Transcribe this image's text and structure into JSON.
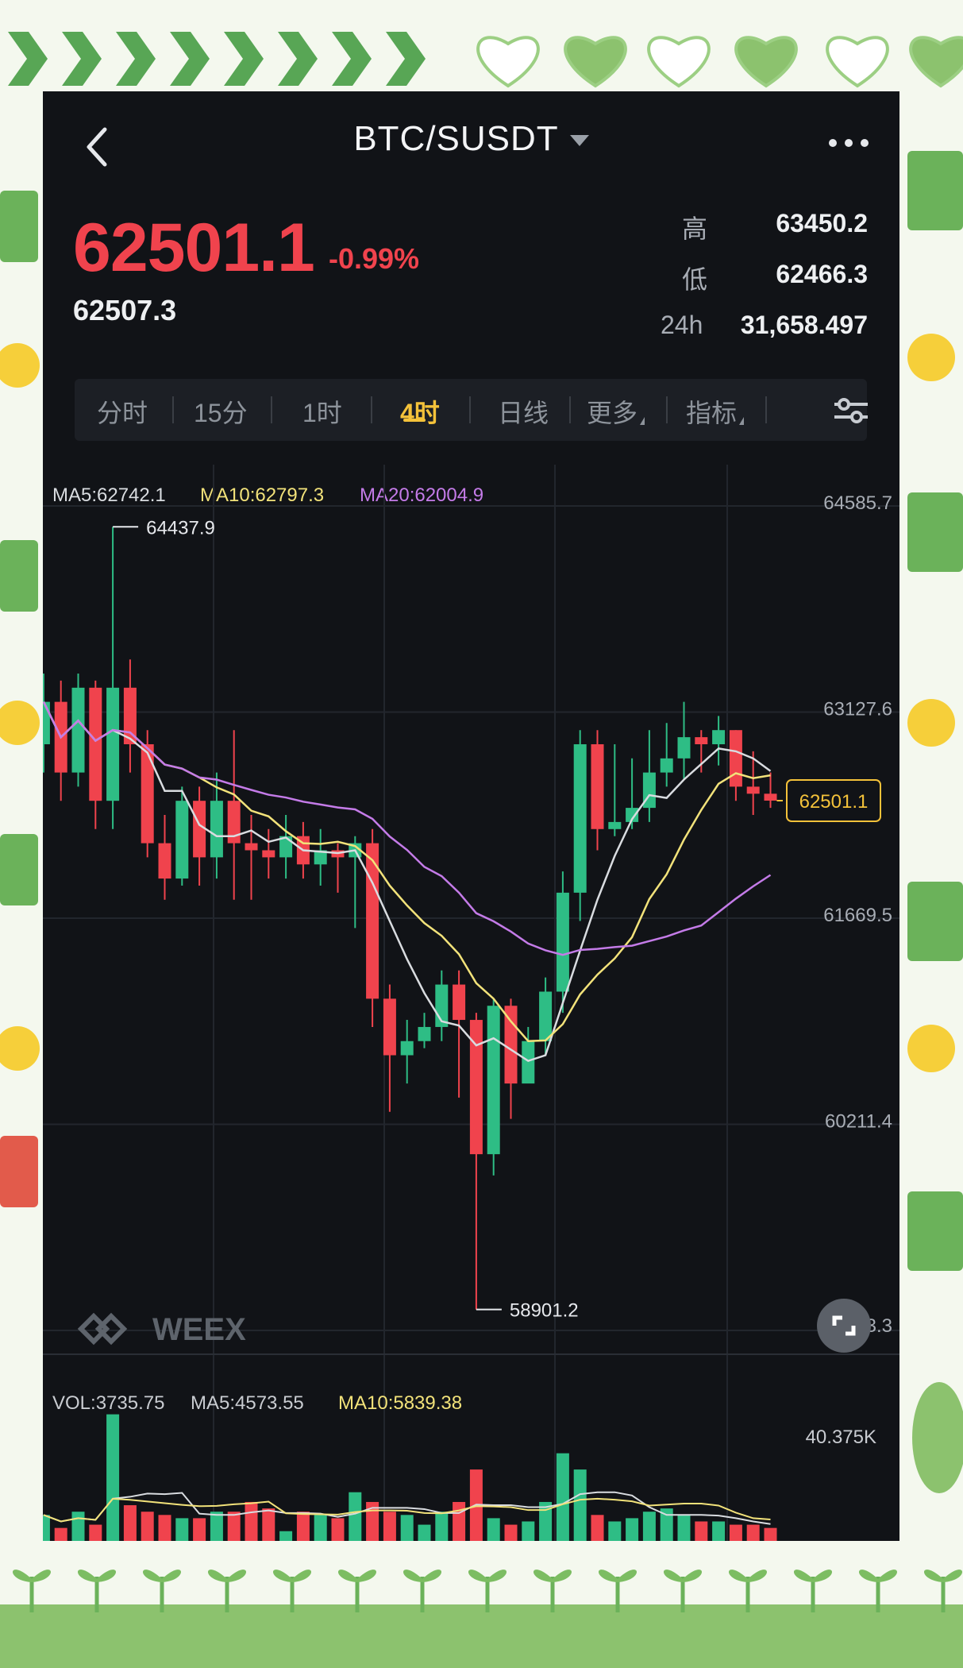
{
  "header": {
    "pair": "BTC/SUSDT"
  },
  "ticker": {
    "last_price": "62501.1",
    "change_pct": "-0.99%",
    "index_price": "62507.3",
    "high_label": "高",
    "high": "63450.2",
    "low_label": "低",
    "low": "62466.3",
    "vol_label": "24h",
    "vol_24h": "31,658.497"
  },
  "tabs": [
    {
      "label": "分时"
    },
    {
      "label": "15分"
    },
    {
      "label": "1时"
    },
    {
      "label": "4时"
    },
    {
      "label": "日线"
    },
    {
      "label": "更多"
    },
    {
      "label": "指标"
    }
  ],
  "active_tab": "4时",
  "ma": {
    "ma5": "MA5:62742.1",
    "ma10": "MA10:62797.3",
    "ma20": "MA20:62004.9"
  },
  "price_axis": [
    "64585.7",
    "63127.6",
    "61669.5",
    "60211.4",
    "58753.3"
  ],
  "annotations": {
    "high_mark": "64437.9",
    "low_mark": "58901.2",
    "current_tag": "62501.1"
  },
  "volume": {
    "vol": "VOL:3735.75",
    "ma5": "MA5:4573.55",
    "ma10": "MA10:5839.38",
    "axis_max": "40.375K"
  },
  "brand": {
    "logo_text": "WEEX"
  },
  "colors": {
    "up": "#2ebd85",
    "down": "#f0434d",
    "ma5": "#d9dce0",
    "ma10": "#f2e27a",
    "ma20": "#c47be8",
    "accent": "#f4c23a"
  },
  "chart_data": {
    "type": "candlestick",
    "ylim": [
      58753.3,
      64585.7
    ],
    "candles": [
      [
        62900,
        63200,
        63400,
        62700
      ],
      [
        63200,
        62700,
        63350,
        62500
      ],
      [
        62700,
        63300,
        63400,
        62600
      ],
      [
        63300,
        62500,
        63350,
        62300
      ],
      [
        62500,
        63300,
        64437.9,
        62300
      ],
      [
        63300,
        62900,
        63500,
        62700
      ],
      [
        62900,
        62200,
        63000,
        62100
      ],
      [
        62200,
        61950,
        62400,
        61800
      ],
      [
        61950,
        62500,
        62600,
        61900
      ],
      [
        62500,
        62100,
        62600,
        61900
      ],
      [
        62100,
        62500,
        62700,
        61950
      ],
      [
        62500,
        62200,
        63000,
        61800
      ],
      [
        62200,
        62150,
        62400,
        61800
      ],
      [
        62150,
        62100,
        62300,
        61950
      ],
      [
        62100,
        62250,
        62400,
        61950
      ],
      [
        62250,
        62050,
        62350,
        61950
      ],
      [
        62050,
        62150,
        62300,
        61900
      ],
      [
        62150,
        62100,
        62200,
        61850
      ],
      [
        62100,
        62200,
        62250,
        61600
      ],
      [
        62200,
        61100,
        62300,
        60900
      ],
      [
        61100,
        60700,
        61200,
        60300
      ],
      [
        60700,
        60800,
        60950,
        60500
      ],
      [
        60800,
        60900,
        61000,
        60750
      ],
      [
        60900,
        61200,
        61300,
        60800
      ],
      [
        61200,
        60950,
        61300,
        60400
      ],
      [
        60950,
        60000,
        61000,
        58901.2
      ],
      [
        60000,
        61050,
        61100,
        59850
      ],
      [
        61050,
        60500,
        61100,
        60250
      ],
      [
        60500,
        60800,
        60900,
        60600
      ],
      [
        60800,
        61150,
        61250,
        60700
      ],
      [
        61150,
        61850,
        62000,
        61000
      ],
      [
        61850,
        62900,
        63000,
        61650
      ],
      [
        62900,
        62300,
        63000,
        62150
      ],
      [
        62300,
        62350,
        62900,
        62250
      ],
      [
        62350,
        62450,
        62800,
        62300
      ],
      [
        62450,
        62700,
        63000,
        62350
      ],
      [
        62700,
        62800,
        63050,
        62600
      ],
      [
        62800,
        62950,
        63200,
        62650
      ],
      [
        62950,
        62900,
        63000,
        62700
      ],
      [
        62900,
        63000,
        63100,
        62750
      ],
      [
        63000,
        62600,
        63000,
        62500
      ],
      [
        62600,
        62550,
        62850,
        62400
      ],
      [
        62550,
        62501.1,
        62700,
        62450
      ]
    ],
    "volumes": [
      8,
      4,
      9,
      5,
      39,
      11,
      9,
      8,
      7,
      7,
      9,
      9,
      12,
      10,
      3,
      9,
      8,
      7,
      15,
      12,
      9,
      8,
      5,
      9,
      12,
      22,
      7,
      5,
      6,
      12,
      27,
      22,
      8,
      6,
      7,
      9,
      10,
      8,
      6,
      6,
      5,
      5,
      4
    ],
    "volume_ylim": [
      0,
      40.375
    ]
  }
}
